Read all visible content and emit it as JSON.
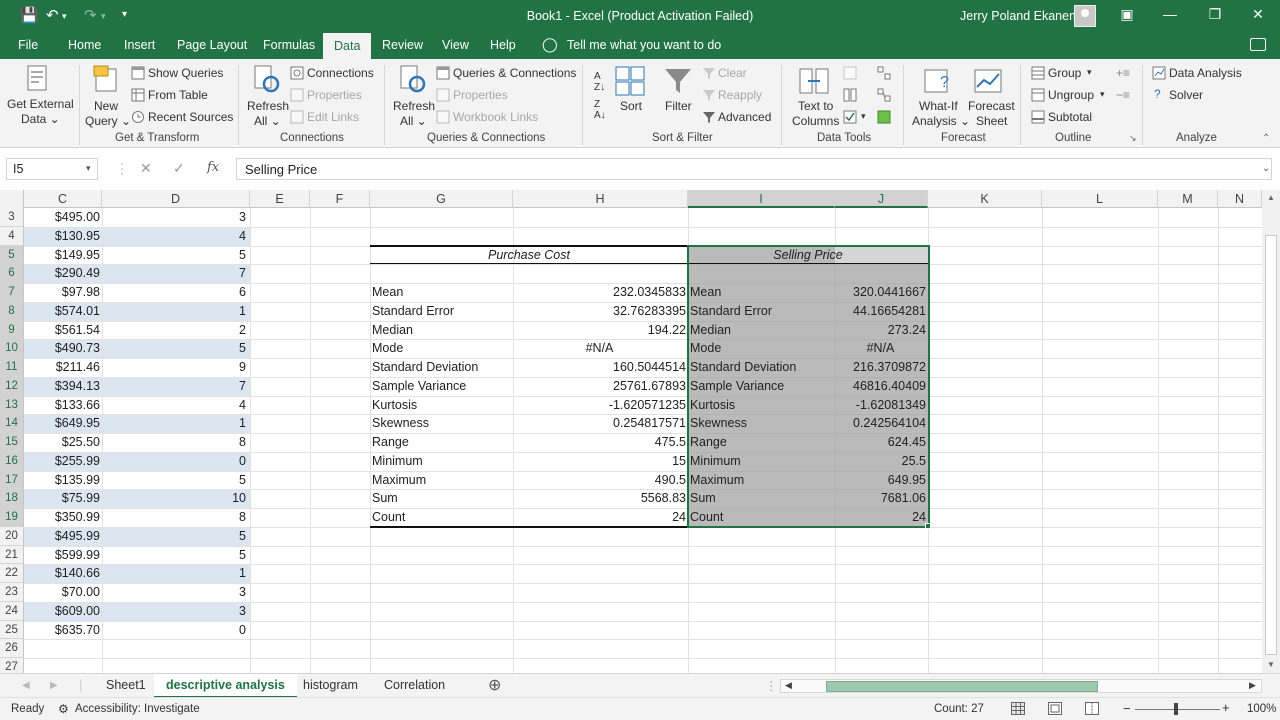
{
  "titlebar": {
    "title": "Book1  -  Excel (Product Activation Failed)",
    "user": "Jerry Poland  Ekanem"
  },
  "menu": {
    "tabs": [
      "File",
      "Home",
      "Insert",
      "Page Layout",
      "Formulas",
      "Data",
      "Review",
      "View",
      "Help"
    ],
    "active": "Data",
    "tell_me": "Tell me what you want to do"
  },
  "ribbon": {
    "get_external_data": [
      "Get External",
      "Data ⌄"
    ],
    "new_query": [
      "New",
      "Query ⌄"
    ],
    "show_queries": "Show Queries",
    "from_table": "From Table",
    "recent_sources": "Recent Sources",
    "get_transform": "Get & Transform",
    "refresh_all": [
      "Refresh",
      "All ⌄"
    ],
    "connections": "Connections",
    "properties": "Properties",
    "edit_links": "Edit Links",
    "connections_group": "Connections",
    "refresh_all2": [
      "Refresh",
      "All ⌄"
    ],
    "queries_connections": "Queries & Connections",
    "properties2": "Properties",
    "workbook_links": "Workbook Links",
    "queries_group": "Queries & Connections",
    "sort": "Sort",
    "filter": "Filter",
    "clear": "Clear",
    "reapply": "Reapply",
    "advanced": "Advanced",
    "sort_filter_group": "Sort & Filter",
    "text_to_columns": [
      "Text to",
      "Columns"
    ],
    "data_tools_group": "Data Tools",
    "what_if": [
      "What-If",
      "Analysis ⌄"
    ],
    "forecast_sheet": [
      "Forecast",
      "Sheet"
    ],
    "forecast_group": "Forecast",
    "group": "Group",
    "ungroup": "Ungroup",
    "subtotal": "Subtotal",
    "outline_group": "Outline",
    "data_analysis": "Data Analysis",
    "solver": "Solver",
    "analyze_group": "Analyze"
  },
  "formula_bar": {
    "name_box": "I5",
    "formula": "Selling Price",
    "fx": "fx"
  },
  "columns": [
    "C",
    "D",
    "E",
    "F",
    "G",
    "H",
    "I",
    "J",
    "K",
    "L",
    "M",
    "N"
  ],
  "rows": [
    "3",
    "4",
    "5",
    "6",
    "7",
    "8",
    "9",
    "10",
    "11",
    "12",
    "13",
    "14",
    "15",
    "16",
    "17",
    "18",
    "19",
    "20",
    "21",
    "22",
    "23",
    "24",
    "25",
    "26",
    "27"
  ],
  "col_c": [
    "$495.00",
    "$130.95",
    "$149.95",
    "$290.49",
    "$97.98",
    "$574.01",
    "$561.54",
    "$490.73",
    "$211.46",
    "$394.13",
    "$133.66",
    "$649.95",
    "$25.50",
    "$255.99",
    "$135.99",
    "$75.99",
    "$350.99",
    "$495.99",
    "$599.99",
    "$140.66",
    "$70.00",
    "$609.00",
    "$635.70"
  ],
  "col_d": [
    "3",
    "4",
    "5",
    "7",
    "6",
    "1",
    "2",
    "5",
    "9",
    "7",
    "4",
    "1",
    "8",
    "0",
    "5",
    "10",
    "8",
    "5",
    "5",
    "1",
    "3",
    "3",
    "0"
  ],
  "stats": {
    "purchase_header": "Purchase Cost",
    "selling_header": "Selling Price",
    "labels": [
      "Mean",
      "Standard Error",
      "Median",
      "Mode",
      "Standard Deviation",
      "Sample Variance",
      "Kurtosis",
      "Skewness",
      "Range",
      "Minimum",
      "Maximum",
      "Sum",
      "Count"
    ],
    "purchase_values": [
      "232.0345833",
      "32.76283395",
      "194.22",
      "#N/A",
      "160.5044514",
      "25761.67893",
      "-1.620571235",
      "0.254817571",
      "475.5",
      "15",
      "490.5",
      "5568.83",
      "24"
    ],
    "selling_values": [
      "320.0441667",
      "44.16654281",
      "273.24",
      "#N/A",
      "216.3709872",
      "46816.40409",
      "-1.62081349",
      "0.242564104",
      "624.45",
      "25.5",
      "649.95",
      "7681.06",
      "24"
    ]
  },
  "sheets": [
    "Sheet1",
    "descriptive analysis",
    "histogram",
    "Correlation"
  ],
  "active_sheet": "descriptive analysis",
  "status": {
    "ready": "Ready",
    "accessibility": "Accessibility: Investigate",
    "count": "Count: 27",
    "zoom": "100%"
  },
  "colors": {
    "accent": "#217346",
    "band": "#dce6f1",
    "selection": "#a0a0a0"
  }
}
